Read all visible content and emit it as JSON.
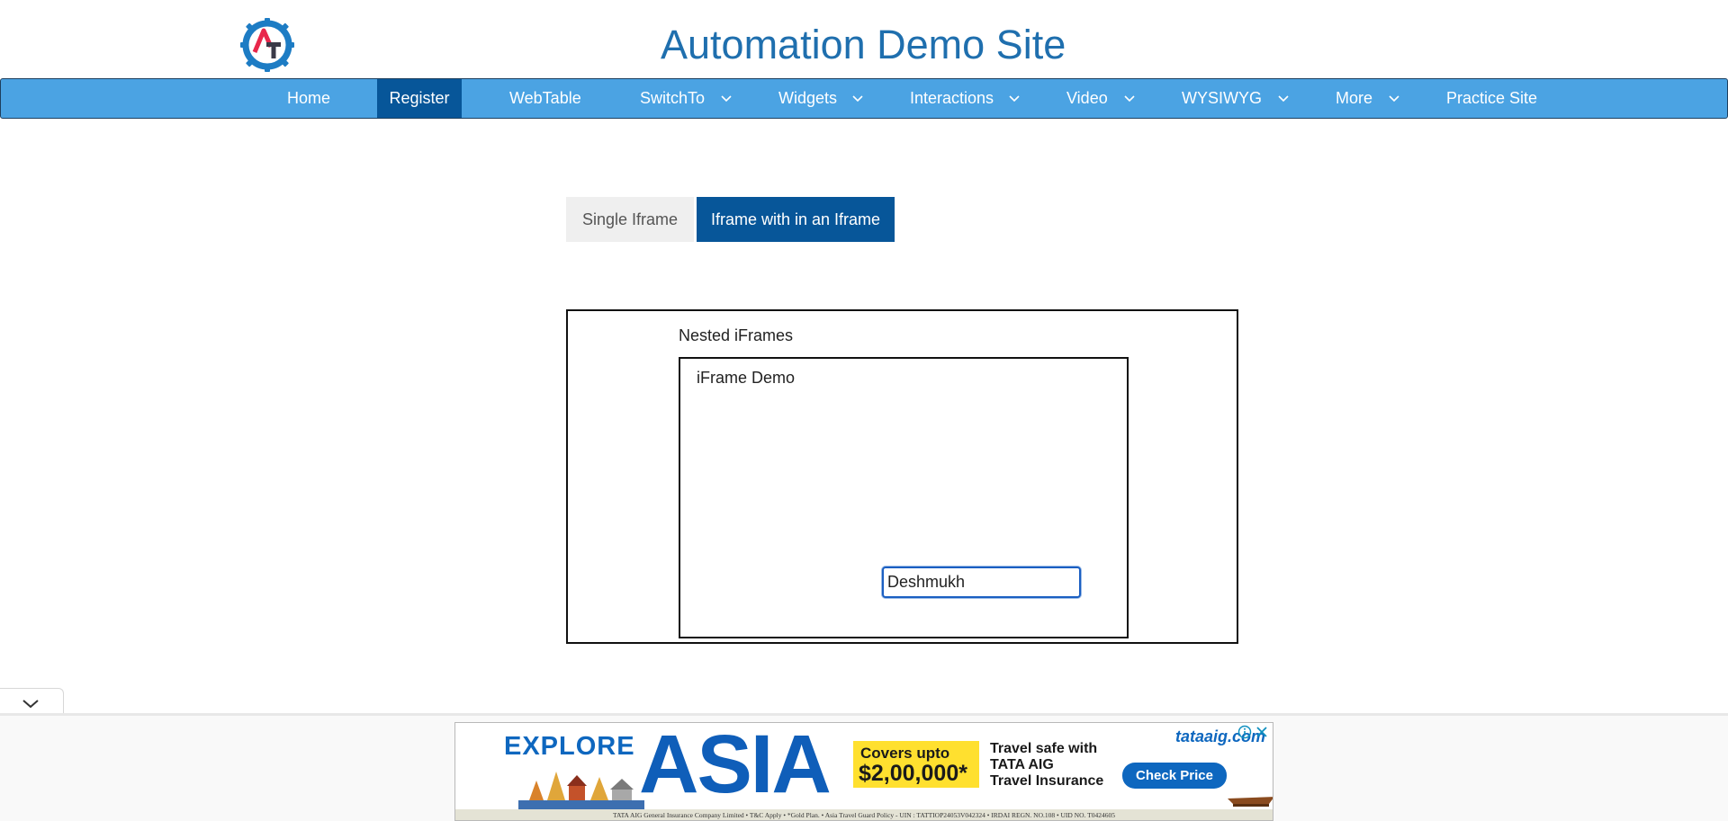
{
  "header": {
    "logo_icon": "gear-logo-icon",
    "title": "Automation Demo Site"
  },
  "nav": {
    "items": [
      {
        "label": "Home",
        "dropdown": false
      },
      {
        "label": "Register",
        "dropdown": false,
        "active": true
      },
      {
        "label": "WebTable",
        "dropdown": false
      },
      {
        "label": "SwitchTo",
        "dropdown": true
      },
      {
        "label": "Widgets",
        "dropdown": true
      },
      {
        "label": "Interactions",
        "dropdown": true
      },
      {
        "label": "Video",
        "dropdown": true
      },
      {
        "label": "WYSIWYG",
        "dropdown": true
      },
      {
        "label": "More",
        "dropdown": true
      },
      {
        "label": "Practice Site",
        "dropdown": false
      }
    ]
  },
  "tabs": [
    {
      "label": "Single Iframe",
      "active": false
    },
    {
      "label": "Iframe with in an Iframe",
      "active": true
    }
  ],
  "outer_iframe": {
    "heading": "Nested iFrames"
  },
  "inner_iframe": {
    "heading": "iFrame Demo",
    "input_value": "Deshmukh"
  },
  "ad": {
    "headline_small": "EXPLORE",
    "headline_big": "ASIA",
    "covers_line1": "Covers upto",
    "covers_line2": "$2,00,000*",
    "travel_line1": "Travel safe with",
    "travel_line2": "TATA AIG",
    "travel_line3": "Travel Insurance",
    "cta": "Check Price",
    "brand": "tataaig.com",
    "disclaimer": "TATA AIG General Insurance Company Limited  •  T&C Apply  •  *Gold Plan.  •  Asia Travel Guard Policy - UIN : TATTIOP24053V042324  •  IRDAI REGN. NO.108  •  UID NO. T0424605"
  },
  "colors": {
    "title": "#1f6fae",
    "navbar": "#4ba3e3",
    "active": "#075699",
    "ad_blue": "#0e67bf",
    "ad_yellow": "#ffe02f"
  }
}
